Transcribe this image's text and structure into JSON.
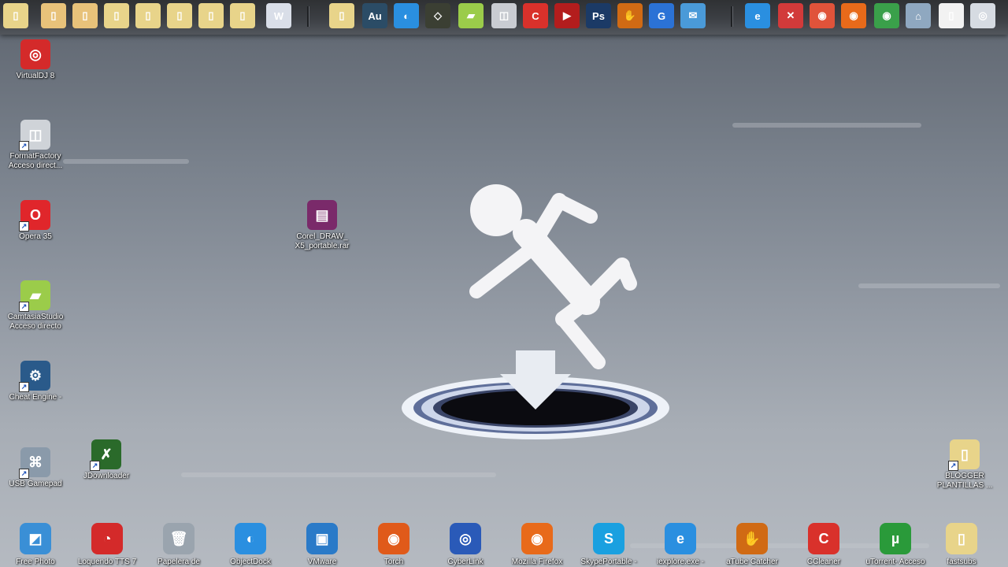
{
  "top_dock": {
    "items": [
      {
        "name": "folder-1-icon",
        "glyph": "▯",
        "color": "#e8d48a"
      },
      {
        "name": "folder-2-icon",
        "glyph": "▯",
        "color": "#e8c27a"
      },
      {
        "name": "folder-3-icon",
        "glyph": "▯",
        "color": "#e8c27a"
      },
      {
        "name": "folder-4-icon",
        "glyph": "▯",
        "color": "#e8d48a"
      },
      {
        "name": "folder-5-icon",
        "glyph": "▯",
        "color": "#e8d48a"
      },
      {
        "name": "folder-6-icon",
        "glyph": "▯",
        "color": "#e8d48a"
      },
      {
        "name": "folder-7-icon",
        "glyph": "▯",
        "color": "#e8d48a"
      },
      {
        "name": "folder-8-icon",
        "glyph": "▯",
        "color": "#e8d48a"
      },
      {
        "name": "word-document-icon",
        "glyph": "W",
        "color": "#d9dee8"
      },
      {
        "name": "folder-9-icon",
        "glyph": "▯",
        "color": "#e8d48a"
      },
      {
        "name": "adobe-audition-icon",
        "glyph": "Au",
        "color": "#2b4c66"
      },
      {
        "name": "objectdock-icon",
        "glyph": "◐",
        "color": "#2a8fe0"
      },
      {
        "name": "corel-icon",
        "glyph": "◇",
        "color": "#3b3f33"
      },
      {
        "name": "camtasia-icon",
        "glyph": "▰",
        "color": "#9bcc4a"
      },
      {
        "name": "format-factory-icon",
        "glyph": "◫",
        "color": "#c9ccd2"
      },
      {
        "name": "ccleaner-icon",
        "glyph": "C",
        "color": "#d9312b"
      },
      {
        "name": "media-player-icon",
        "glyph": "▶",
        "color": "#b31d1d"
      },
      {
        "name": "photoshop-icon",
        "glyph": "Ps",
        "color": "#1b3a66"
      },
      {
        "name": "atube-catcher-icon",
        "glyph": "✋",
        "color": "#d06a14"
      },
      {
        "name": "cyberlink-icon",
        "glyph": "G",
        "color": "#2b72d6"
      },
      {
        "name": "email-icon",
        "glyph": "✉",
        "color": "#4a9ad8"
      },
      {
        "name": "internet-explorer-icon",
        "glyph": "e",
        "color": "#2a8fe0"
      },
      {
        "name": "pdf-icon",
        "glyph": "✕",
        "color": "#d23a3a"
      },
      {
        "name": "chrome-canary-icon",
        "glyph": "◉",
        "color": "#e0533a"
      },
      {
        "name": "firefox-icon",
        "glyph": "◉",
        "color": "#e86a1a"
      },
      {
        "name": "chrome-icon",
        "glyph": "◉",
        "color": "#3aa04a"
      },
      {
        "name": "network-icon",
        "glyph": "⌂",
        "color": "#8fa8c0"
      },
      {
        "name": "blank-document-icon",
        "glyph": "▯",
        "color": "#f2f2f2"
      },
      {
        "name": "control-panel-icon",
        "glyph": "◎",
        "color": "#d6dbe2"
      }
    ]
  },
  "desktop_icons": [
    {
      "name": "virtualdj-icon",
      "label": "VirtualDJ 8",
      "glyph": "◎",
      "color": "#d42a2a",
      "shortcut": false
    },
    {
      "name": "formatfactory-icon",
      "label": "FormatFactory\nAcceso direct...",
      "glyph": "◫",
      "color": "#cfd3d8",
      "shortcut": true
    },
    {
      "name": "opera-icon",
      "label": "Opera 35",
      "glyph": "O",
      "color": "#e0262b",
      "shortcut": true
    },
    {
      "name": "camtasia-studio-icon",
      "label": "CamtasiaStudio\nAcceso directo",
      "glyph": "▰",
      "color": "#9bcc4a",
      "shortcut": true
    },
    {
      "name": "cheat-engine-icon",
      "label": "Cheat Engine -",
      "glyph": "⚙",
      "color": "#2a5a8a",
      "shortcut": true
    },
    {
      "name": "usb-gamepad-icon",
      "label": "USB Gamepad",
      "glyph": "⌘",
      "color": "#8a9aaa",
      "shortcut": true
    },
    {
      "name": "jdownloader-icon",
      "label": "JDownloader",
      "glyph": "✗",
      "color": "#2a6a2a",
      "shortcut": true
    },
    {
      "name": "corel-draw-rar-icon",
      "label": "Corel_DRAW_\nX5_portable.rar",
      "glyph": "▤",
      "color": "#7a2a6a",
      "shortcut": false
    },
    {
      "name": "blogger-plantillas-icon",
      "label": "BLOGGER\nPLANTILLAS ...",
      "glyph": "▯",
      "color": "#e8d48a",
      "shortcut": true
    }
  ],
  "bottom_dock": [
    {
      "name": "free-photo-icon",
      "label": "Free Photo",
      "glyph": "◩",
      "color": "#3a8fd6"
    },
    {
      "name": "loquendo-tts-icon",
      "label": "Loquendo TTS 7",
      "glyph": "◔",
      "color": "#d42a2a"
    },
    {
      "name": "recycle-bin-icon",
      "label": "Papelera de",
      "glyph": "🗑",
      "color": "#9aa4ae"
    },
    {
      "name": "objectdock-icon",
      "label": "ObjectDock",
      "glyph": "◐",
      "color": "#2a8fe0"
    },
    {
      "name": "vmware-icon",
      "label": "VMware",
      "glyph": "▣",
      "color": "#2a7ac8"
    },
    {
      "name": "torch-icon",
      "label": "Torch",
      "glyph": "◉",
      "color": "#e05a1a"
    },
    {
      "name": "cyberlink-icon",
      "label": "CyberLink",
      "glyph": "◎",
      "color": "#2a5ab8"
    },
    {
      "name": "mozilla-firefox-icon",
      "label": "Mozilla Firefox",
      "glyph": "◉",
      "color": "#e86a1a"
    },
    {
      "name": "skype-portable-icon",
      "label": "SkypePortable -",
      "glyph": "S",
      "color": "#1aa0e0"
    },
    {
      "name": "iexplore-icon",
      "label": "iexplore.exe -",
      "glyph": "e",
      "color": "#2a8fe0"
    },
    {
      "name": "atube-catcher-icon",
      "label": "aTube Catcher",
      "glyph": "✋",
      "color": "#d06a14"
    },
    {
      "name": "ccleaner-icon",
      "label": "CCleaner",
      "glyph": "C",
      "color": "#d9312b"
    },
    {
      "name": "utorrent-icon",
      "label": "uTorrent- Acceso",
      "glyph": "µ",
      "color": "#2a9a3a"
    },
    {
      "name": "fastsubs-icon",
      "label": "fastsubs",
      "glyph": "▯",
      "color": "#e8d48a"
    }
  ],
  "wallpaper": {
    "accent": "#f2f2f2"
  }
}
